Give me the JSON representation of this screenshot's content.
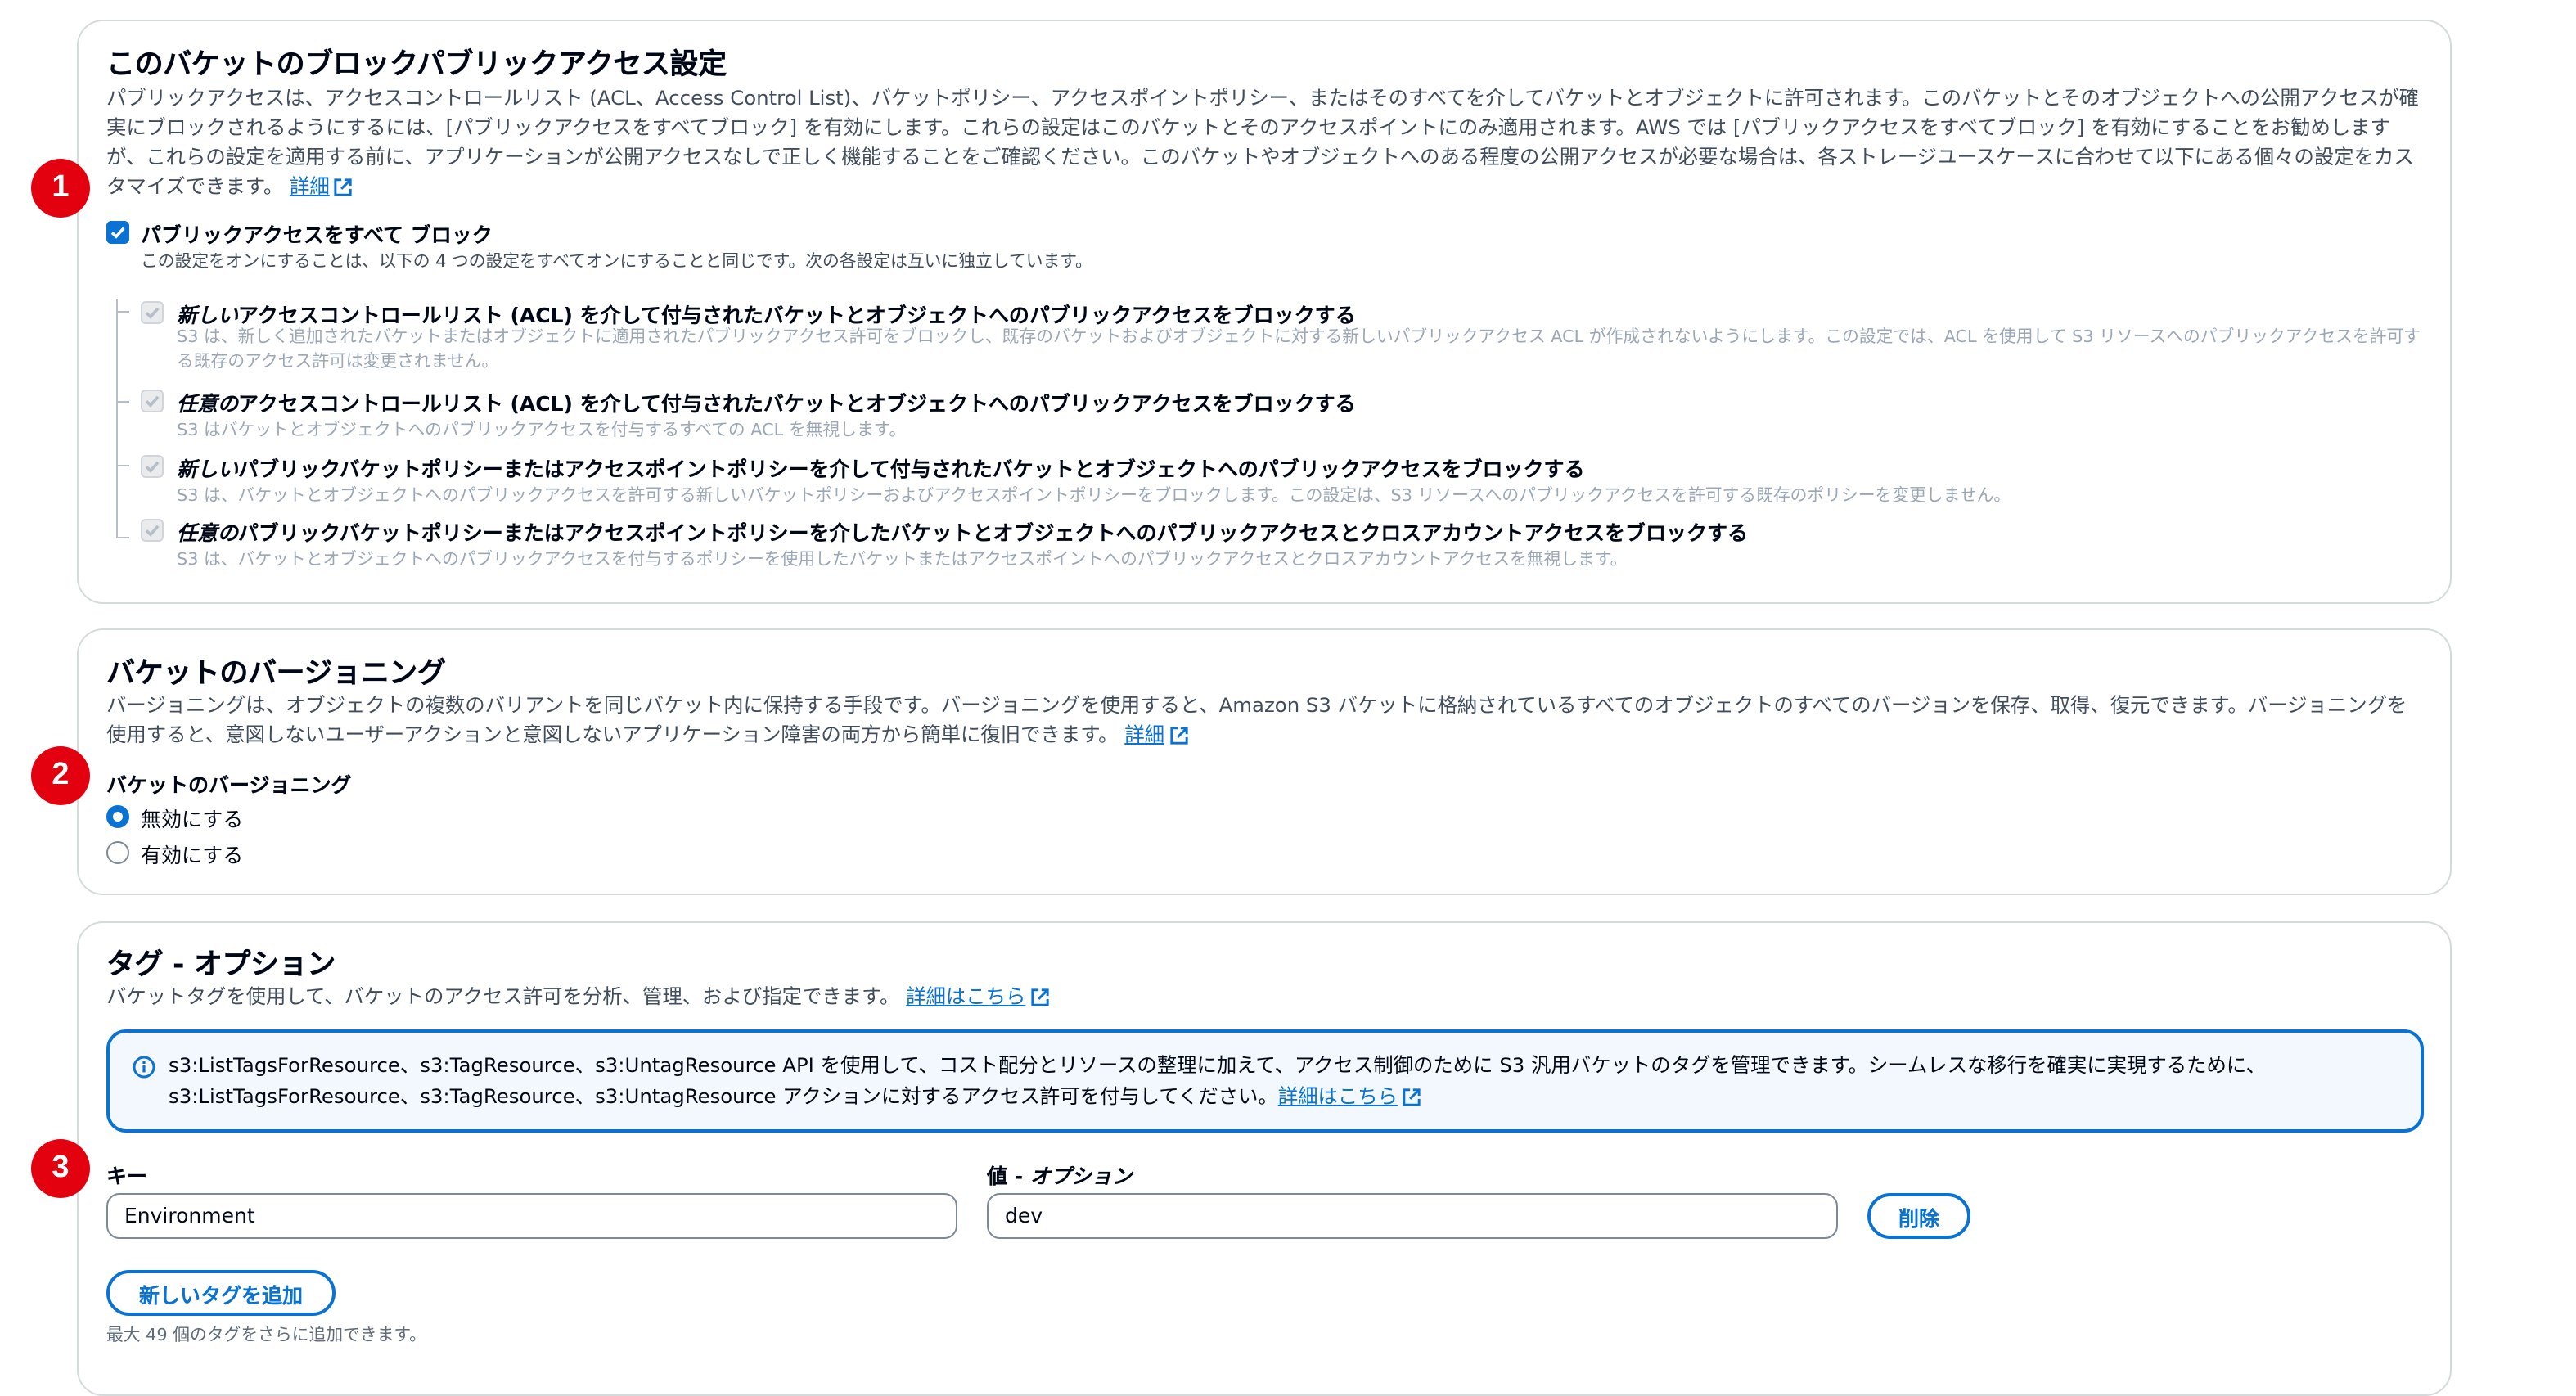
{
  "block_public_access": {
    "title": "このバケットのブロックパブリックアクセス設定",
    "description": "パブリックアクセスは、アクセスコントロールリスト (ACL、Access Control List)、バケットポリシー、アクセスポイントポリシー、またはそのすべてを介してバケットとオブジェクトに許可されます。このバケットとそのオブジェクトへの公開アクセスが確実にブロックされるようにするには、[パブリックアクセスをすべてブロック] を有効にします。これらの設定はこのバケットとそのアクセスポイントにのみ適用されます。AWS では [パブリックアクセスをすべてブロック] を有効にすることをお勧めしますが、これらの設定を適用する前に、アプリケーションが公開アクセスなしで正しく機能することをご確認ください。このバケットやオブジェクトへのある程度の公開アクセスが必要な場合は、各ストレージユースケースに合わせて以下にある個々の設定をカスタマイズできます。",
    "learn_more": "詳細",
    "block_all": {
      "label": "パブリックアクセスをすべて ブロック",
      "sub": "この設定をオンにすることは、以下の 4 つの設定をすべてオンにすることと同じです。次の各設定は互いに独立しています。",
      "checked": true
    },
    "options": [
      {
        "label_em": "新しい",
        "label_rest": "アクセスコントロールリスト (ACL) を介して付与されたバケットとオブジェクトへのパブリックアクセスをブロックする",
        "sub": "S3 は、新しく追加されたバケットまたはオブジェクトに適用されたパブリックアクセス許可をブロックし、既存のバケットおよびオブジェクトに対する新しいパブリックアクセス ACL が作成されないようにします。この設定では、ACL を使用して S3 リソースへのパブリックアクセスを許可する既存のアクセス許可は変更されません。"
      },
      {
        "label_em": "任意の",
        "label_rest": "アクセスコントロールリスト (ACL) を介して付与されたバケットとオブジェクトへのパブリックアクセスをブロックする",
        "sub": "S3 はバケットとオブジェクトへのパブリックアクセスを付与するすべての ACL を無視します。"
      },
      {
        "label_em": "新しい",
        "label_rest": "パブリックバケットポリシーまたはアクセスポイントポリシーを介して付与されたバケットとオブジェクトへのパブリックアクセスをブロックする",
        "sub": "S3 は、バケットとオブジェクトへのパブリックアクセスを許可する新しいバケットポリシーおよびアクセスポイントポリシーをブロックします。この設定は、S3 リソースへのパブリックアクセスを許可する既存のポリシーを変更しません。"
      },
      {
        "label_em": "任意の",
        "label_rest": "パブリックバケットポリシーまたはアクセスポイントポリシーを介したバケットとオブジェクトへのパブリックアクセスとクロスアカウントアクセスをブロックする",
        "sub": "S3 は、バケットとオブジェクトへのパブリックアクセスを付与するポリシーを使用したバケットまたはアクセスポイントへのパブリックアクセスとクロスアカウントアクセスを無視します。"
      }
    ]
  },
  "versioning": {
    "title": "バケットのバージョニング",
    "description": "バージョニングは、オブジェクトの複数のバリアントを同じバケット内に保持する手段です。バージョニングを使用すると、Amazon S3 バケットに格納されているすべてのオブジェクトのすべてのバージョンを保存、取得、復元できます。バージョニングを使用すると、意図しないユーザーアクションと意図しないアプリケーション障害の両方から簡単に復旧できます。",
    "learn_more": "詳細",
    "field_label": "バケットのバージョニング",
    "options": [
      "無効にする",
      "有効にする"
    ],
    "selected": "無効にする"
  },
  "tags": {
    "title": "タグ - オプション",
    "description": "バケットタグを使用して、バケットのアクセス許可を分析、管理、および指定できます。",
    "learn_more": "詳細はこちら",
    "info_line1": "s3:ListTagsForResource、s3:TagResource、s3:UntagResource API を使用して、コスト配分とリソースの整理に加えて、アクセス制御のために S3 汎用バケットのタグを管理できます。シームレスな移行を確実に実現するために、",
    "info_line2": "s3:ListTagsForResource、s3:TagResource、s3:UntagResource アクションに対するアクセス許可を付与してください。",
    "info_learn_more": "詳細はこちら",
    "key_label": "キー",
    "value_label_prefix": "値 - ",
    "value_label_em": "オプション",
    "key_value": "Environment",
    "value_value": "dev",
    "remove_button": "削除",
    "add_button": "新しいタグを追加",
    "hint": "最大 49 個のタグをさらに追加できます。"
  },
  "annotations": [
    "1",
    "2",
    "3"
  ],
  "colors": {
    "accent": "#0972d3",
    "badge": "#e3000f",
    "info_bg": "#f2f8fd"
  },
  "icons": [
    "checkbox-checked-icon",
    "external-link-icon",
    "info-icon"
  ]
}
